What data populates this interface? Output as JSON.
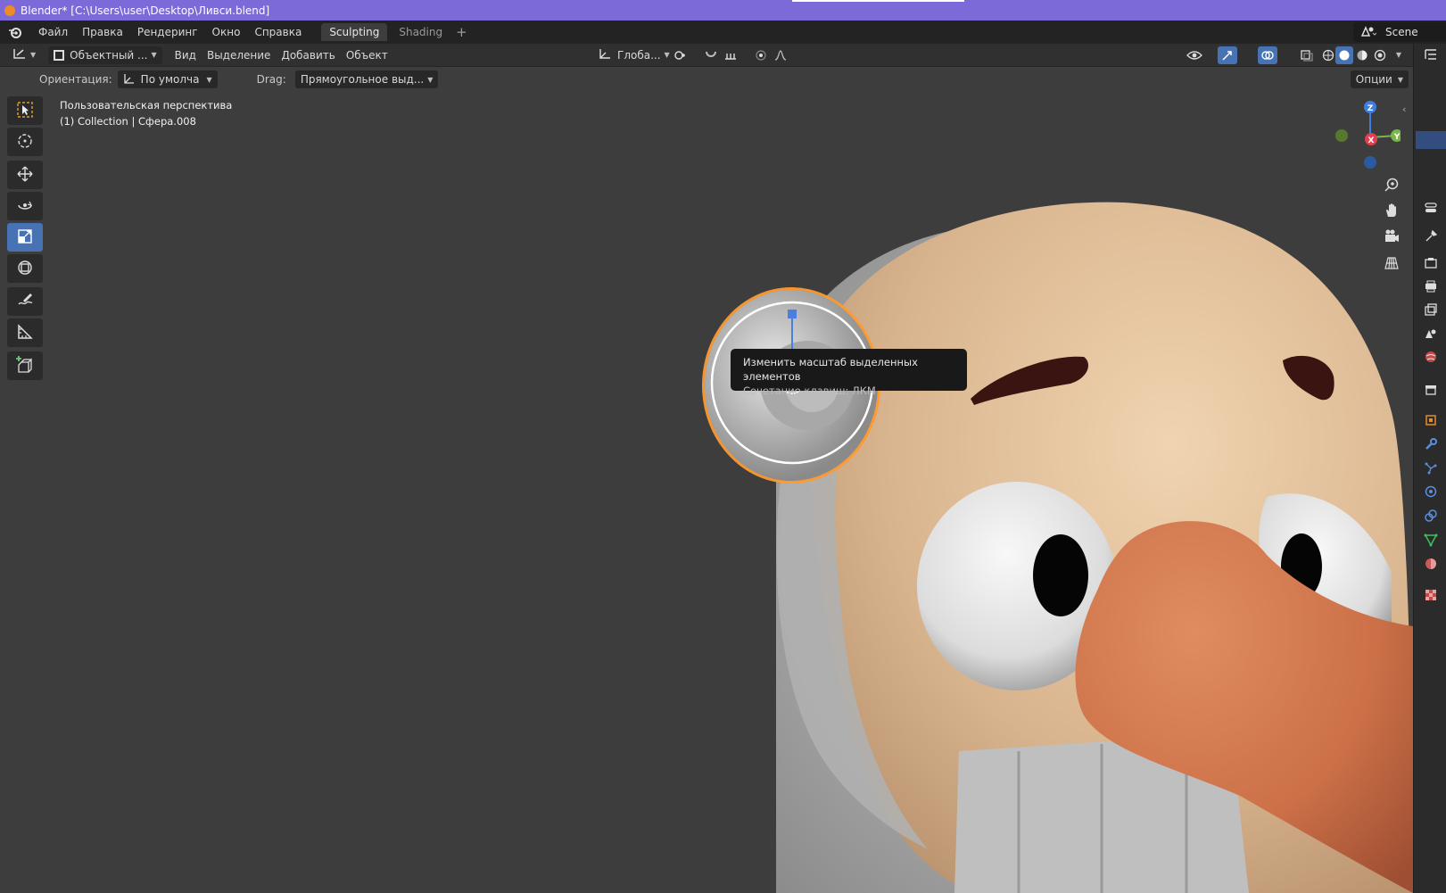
{
  "window": {
    "title": "Blender* [C:\\Users\\user\\Desktop\\Ливси.blend]"
  },
  "menubar": {
    "menus": [
      "Файл",
      "Правка",
      "Рендеринг",
      "Окно",
      "Справка"
    ],
    "tabs": [
      "Sculpting",
      "Shading"
    ],
    "active_tab": "Sculpting",
    "scene": "Scene"
  },
  "header": {
    "mode": "Объектный ...",
    "menus": [
      "Вид",
      "Выделение",
      "Добавить",
      "Объект"
    ],
    "transform_orientation": "Глоба..."
  },
  "toolsettings": {
    "orientation_label": "Ориентация:",
    "orientation_value": "По умолча",
    "drag_label": "Drag:",
    "drag_value": "Прямоугольное выд...",
    "options": "Опции"
  },
  "viewport": {
    "perspective": "Пользовательская перспектива",
    "collection": "(1) Collection | Сфера.008"
  },
  "tooltip": {
    "title": "Изменить масштаб выделенных элементов",
    "shortcut": "Сочетание клавиш: ЛКМ"
  },
  "gizmo": {
    "x": "X",
    "y": "Y",
    "z": "Z"
  },
  "colors": {
    "title_bar": "#7b6ad8",
    "active": "#4772b3",
    "skin": "#e2c4a0",
    "nose": "#d4784e"
  }
}
